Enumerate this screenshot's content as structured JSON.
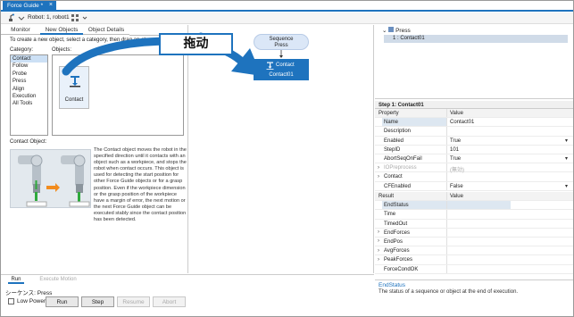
{
  "window": {
    "tab_title": "Force Guide *",
    "close_glyph": "×"
  },
  "toolbar": {
    "robot_label": "Robot: 1, robot1",
    "robot_icon": "robot-icon",
    "settings_icon": "grid-icon"
  },
  "left_tabs": [
    {
      "label": "Monitor"
    },
    {
      "label": "New Objects"
    },
    {
      "label": "Object Details"
    }
  ],
  "left": {
    "instruction": "To create a new object, select a category, then drag an ob",
    "category_label": "Category:",
    "objects_label": "Objects:",
    "categories": [
      "Contact",
      "Follow",
      "Probe",
      "Press",
      "Align",
      "Execution",
      "All Tools"
    ],
    "selected_category": "Contact",
    "object_card_label": "Contact",
    "contact_object_label": "Contact Object:",
    "description": "The Contact object moves the robot in the specified direction until it contacts with an object such as a workpiece, and stops the robot when contact occurs. This object is used for detecting the start position for other Force Guide objects or for a grasp position. Even if the workpiece dimension or the grasp position of the workpiece have a margin of error, the next motion or the next Force Guide object can be executed stably since the contact position has been detected."
  },
  "canvas": {
    "sequence_line1": "Sequence",
    "sequence_line2": "Press",
    "contact_title": "Contact",
    "contact_name": "Contact01"
  },
  "overlay": {
    "callout_text": "拖动"
  },
  "tree": {
    "root": "Press",
    "child": "1 : Contact01"
  },
  "properties": {
    "step_header": "Step 1: Contact01",
    "col_property": "Property",
    "col_value": "Value",
    "rows": [
      {
        "name": "Name",
        "value": "Contact01",
        "expand": "",
        "dropdown": ""
      },
      {
        "name": "Description",
        "value": "",
        "expand": "",
        "dropdown": ""
      },
      {
        "name": "Enabled",
        "value": "True",
        "expand": "",
        "dropdown": "▾"
      },
      {
        "name": "StepID",
        "value": "101",
        "expand": "",
        "dropdown": ""
      },
      {
        "name": "AbortSeqOnFail",
        "value": "True",
        "expand": "",
        "dropdown": "▾"
      },
      {
        "name": "IOPreprocess",
        "value": "(無効)",
        "expand": "›",
        "dropdown": ""
      },
      {
        "name": "Contact",
        "value": "",
        "expand": "›",
        "dropdown": ""
      },
      {
        "name": "CFEnabled",
        "value": "False",
        "expand": "",
        "dropdown": "▾"
      }
    ]
  },
  "results": {
    "col_result": "Result",
    "col_value": "Value",
    "rows": [
      {
        "name": "EndStatus",
        "expand": ""
      },
      {
        "name": "Time",
        "expand": ""
      },
      {
        "name": "TimedOut",
        "expand": ""
      },
      {
        "name": "EndForces",
        "expand": "›"
      },
      {
        "name": "EndPos",
        "expand": "›"
      },
      {
        "name": "AvgForces",
        "expand": "›"
      },
      {
        "name": "PeakForces",
        "expand": "›"
      },
      {
        "name": "ForceCondOK",
        "expand": ""
      }
    ]
  },
  "status": {
    "title": "EndStatus",
    "description": "The status of a sequence or object at the end of execution."
  },
  "bottom": {
    "tabs": [
      {
        "label": "Run"
      },
      {
        "label": "Execute Motion"
      }
    ],
    "sequence_label": "シーケンス: Press",
    "low_power_label": "Low Power",
    "buttons": [
      {
        "label": "Run"
      },
      {
        "label": "Step"
      },
      {
        "label": "Resume"
      },
      {
        "label": "Abort"
      }
    ]
  },
  "colors": {
    "accent": "#1e73be",
    "selection": "#cce0f5",
    "node": "#dbe7f7"
  }
}
